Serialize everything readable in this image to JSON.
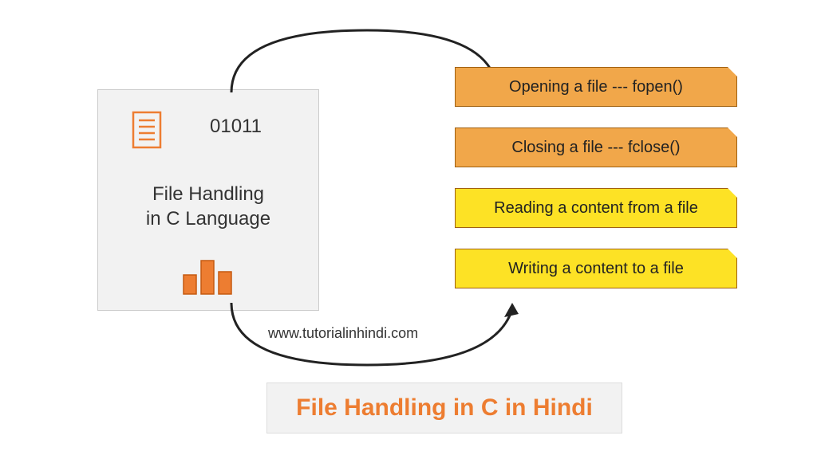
{
  "mainBox": {
    "binary": "01011",
    "titleLine1": "File Handling",
    "titleLine2": "in C Language"
  },
  "operations": [
    "Opening a file --- fopen()",
    "Closing a file --- fclose()",
    "Reading a content from a file",
    "Writing a content to a file"
  ],
  "url": "www.tutorialinhindi.com",
  "footer": "File Handling in C in Hindi",
  "colors": {
    "orange": "#f1a74a",
    "yellow": "#fde225",
    "accent": "#ed7d31"
  }
}
